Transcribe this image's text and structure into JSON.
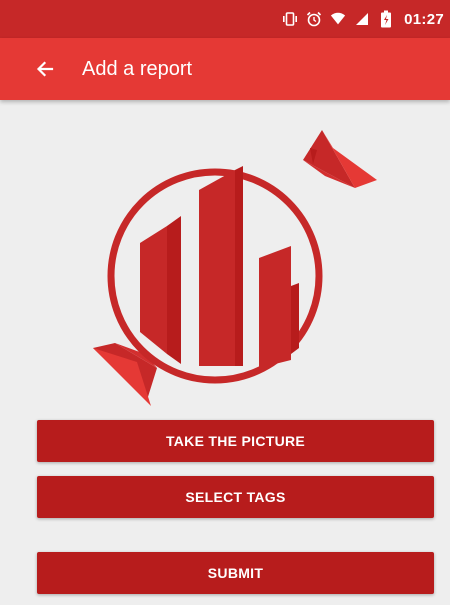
{
  "status_bar": {
    "time": "01:27",
    "icons": [
      "vibrate-icon",
      "alarm-icon",
      "wifi-icon",
      "signal-icon",
      "battery-icon"
    ]
  },
  "app_bar": {
    "title": "Add a report",
    "back_icon": "arrow-back-icon",
    "color": "#e53935"
  },
  "logo": {
    "name": "city-candy-logo",
    "color": "#c62828"
  },
  "buttons": {
    "take_picture": "TAKE THE PICTURE",
    "select_tags": "SELECT TAGS",
    "submit": "SUBMIT"
  },
  "colors": {
    "status_bar": "#c62828",
    "button": "#b71c1c",
    "background": "#eeeeee"
  }
}
